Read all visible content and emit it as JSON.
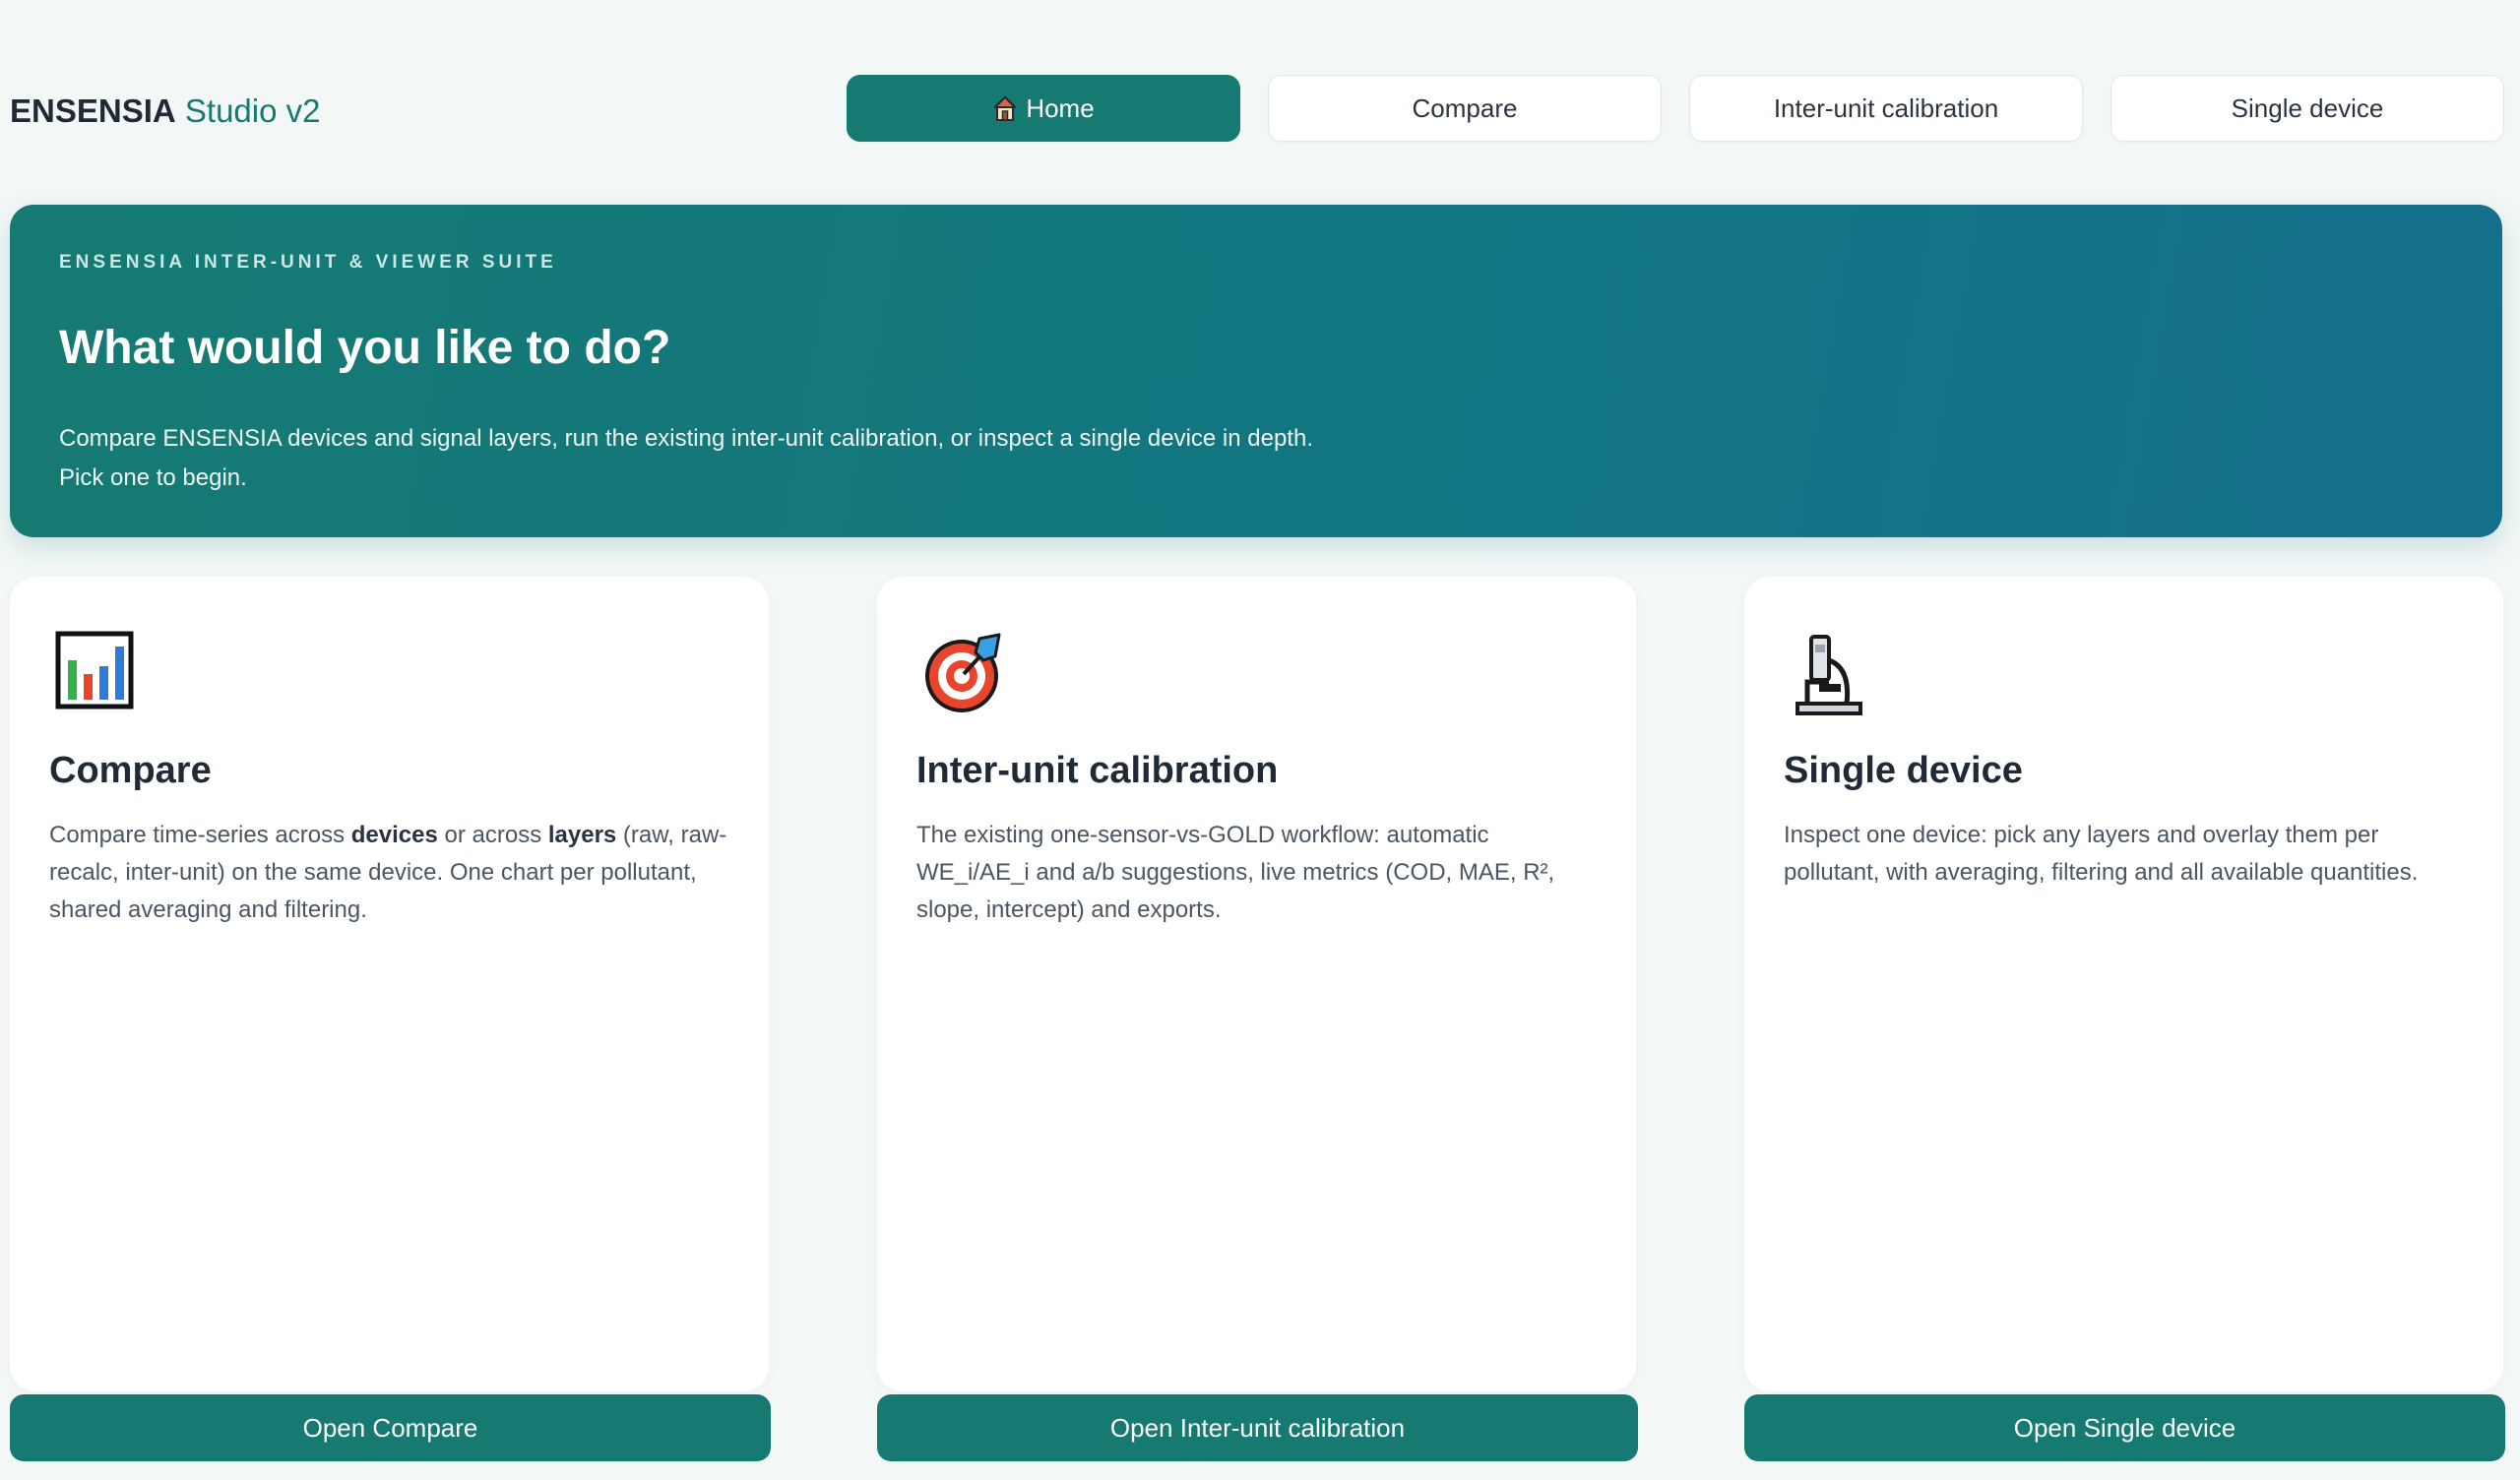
{
  "brand": {
    "name": "ENSENSIA",
    "suffix": "Studio v2"
  },
  "nav": [
    {
      "label": "Home",
      "icon": "house-icon",
      "active": true
    },
    {
      "label": "Compare"
    },
    {
      "label": "Inter-unit calibration"
    },
    {
      "label": "Single device"
    }
  ],
  "hero": {
    "eyebrow": "ENSENSIA INTER-UNIT & VIEWER SUITE",
    "title": "What would you like to do?",
    "desc_line1": "Compare ENSENSIA devices and signal layers, run the existing inter-unit calibration, or inspect a single device in depth.",
    "desc_line2": "Pick one to begin."
  },
  "cards": [
    {
      "icon": "bar-chart-icon",
      "title": "Compare",
      "desc_parts": [
        "Compare time-series across ",
        "devices",
        " or across ",
        "layers",
        " (raw, raw-recalc, inter-unit) on the same device. One chart per pollutant, shared averaging and filtering."
      ],
      "button": "Open Compare"
    },
    {
      "icon": "target-icon",
      "title": "Inter-unit calibration",
      "desc": "The existing one-sensor-vs-GOLD workflow: automatic WE_i/AE_i and a/b suggestions, live metrics (COD, MAE, R², slope, intercept) and exports.",
      "button": "Open Inter-unit calibration"
    },
    {
      "icon": "microscope-icon",
      "title": "Single device",
      "desc": "Inspect one device: pick any layers and overlay them per pollutant, with averaging, filtering and all available quantities.",
      "button": "Open Single device"
    }
  ],
  "colors": {
    "accent": "#167a72",
    "hero_end": "#146f8c",
    "background": "#f3f8f7"
  }
}
